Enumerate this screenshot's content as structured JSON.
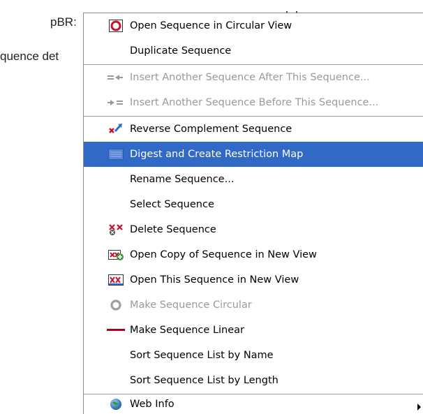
{
  "background": {
    "sequence_name_fragment": "pBR:",
    "details_fragment": "quence det"
  },
  "menu": {
    "items": [
      {
        "label": "Open Sequence in Circular View",
        "icon": "circular-view-icon",
        "disabled": false
      },
      {
        "label": "Duplicate Sequence",
        "icon": "",
        "disabled": false
      },
      {
        "label": "Insert Another Sequence After This Sequence...",
        "icon": "insert-after-icon",
        "disabled": true
      },
      {
        "label": "Insert Another Sequence Before This Sequence...",
        "icon": "insert-before-icon",
        "disabled": true
      },
      {
        "label": "Reverse Complement Sequence",
        "icon": "reverse-complement-icon",
        "disabled": false
      },
      {
        "label": "Digest and Create Restriction Map",
        "icon": "restriction-map-icon",
        "disabled": false,
        "selected": true
      },
      {
        "label": "Rename Sequence...",
        "icon": "",
        "disabled": false
      },
      {
        "label": "Select Sequence",
        "icon": "",
        "disabled": false
      },
      {
        "label": "Delete Sequence",
        "icon": "delete-sequence-icon",
        "disabled": false
      },
      {
        "label": "Open Copy of Sequence in New View",
        "icon": "open-copy-icon",
        "disabled": false
      },
      {
        "label": "Open This Sequence in New View",
        "icon": "open-view-icon",
        "disabled": false
      },
      {
        "label": "Make Sequence Circular",
        "icon": "circle-icon",
        "disabled": true
      },
      {
        "label": "Make Sequence Linear",
        "icon": "linear-icon",
        "disabled": false
      },
      {
        "label": "Sort Sequence List by Name",
        "icon": "",
        "disabled": false
      },
      {
        "label": "Sort Sequence List by Length",
        "icon": "",
        "disabled": false
      },
      {
        "label": "Web Info",
        "icon": "globe-icon",
        "disabled": false,
        "has_submenu": true
      }
    ]
  },
  "colors": {
    "selection": "#3169c6",
    "disabled_text": "#9a9a9a",
    "separator": "#9d9d9d"
  }
}
